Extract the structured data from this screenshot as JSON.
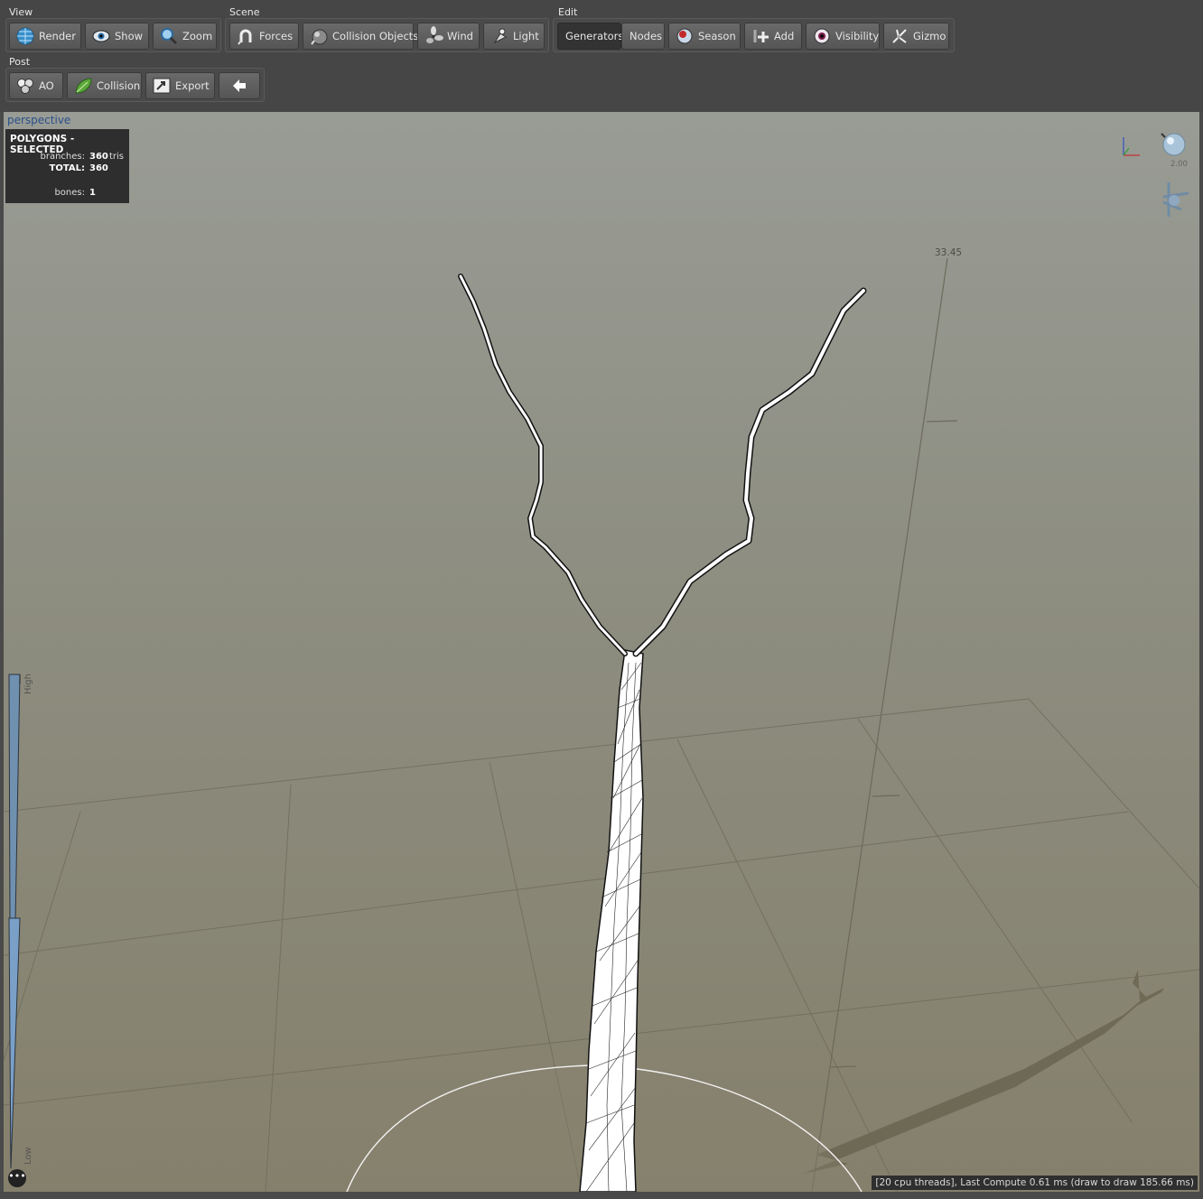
{
  "toolbar": {
    "view": {
      "label": "View",
      "buttons": [
        {
          "label": "Render",
          "icon": "globe-icon"
        },
        {
          "label": "Show",
          "icon": "eye-icon"
        },
        {
          "label": "Zoom",
          "icon": "magnifier-icon"
        }
      ]
    },
    "scene": {
      "label": "Scene",
      "buttons": [
        {
          "label": "Forces",
          "icon": "magnet-icon"
        },
        {
          "label": "Collision Objects",
          "icon": "sphere-icon"
        },
        {
          "label": "Wind",
          "icon": "fan-icon"
        },
        {
          "label": "Light",
          "icon": "lamp-icon"
        }
      ]
    },
    "edit": {
      "label": "Edit",
      "buttons": [
        {
          "label": "Generators",
          "active": true
        },
        {
          "label": "Nodes"
        },
        {
          "label": "Season",
          "icon": "season-icon"
        },
        {
          "label": "Add",
          "icon": "add-icon"
        },
        {
          "label": "Visibility",
          "icon": "eyeball-icon"
        },
        {
          "label": "Gizmo",
          "icon": "gizmo-icon"
        }
      ]
    },
    "post": {
      "label": "Post",
      "buttons": [
        {
          "label": "AO",
          "icon": "ao-icon"
        },
        {
          "label": "Collision",
          "icon": "leaf-icon"
        },
        {
          "label": "Export",
          "icon": "export-icon"
        },
        {
          "label": "",
          "icon": "arrow-left-icon"
        }
      ]
    }
  },
  "viewport": {
    "label": "perspective",
    "stats": {
      "title": "POLYGONS - SELECTED",
      "branches_label": "branches:",
      "branches_value": "360",
      "branches_unit": "tris",
      "total_label": "TOTAL:",
      "total_value": "360",
      "bones_label": "bones:",
      "bones_value": "1"
    },
    "height_marker": "33.45",
    "light_intensity": "2.00",
    "lod_high": "High",
    "lod_low": "Low",
    "status": "[20 cpu threads], Last Compute 0.61 ms (draw to draw 185.66 ms)",
    "more_label": "•••"
  }
}
